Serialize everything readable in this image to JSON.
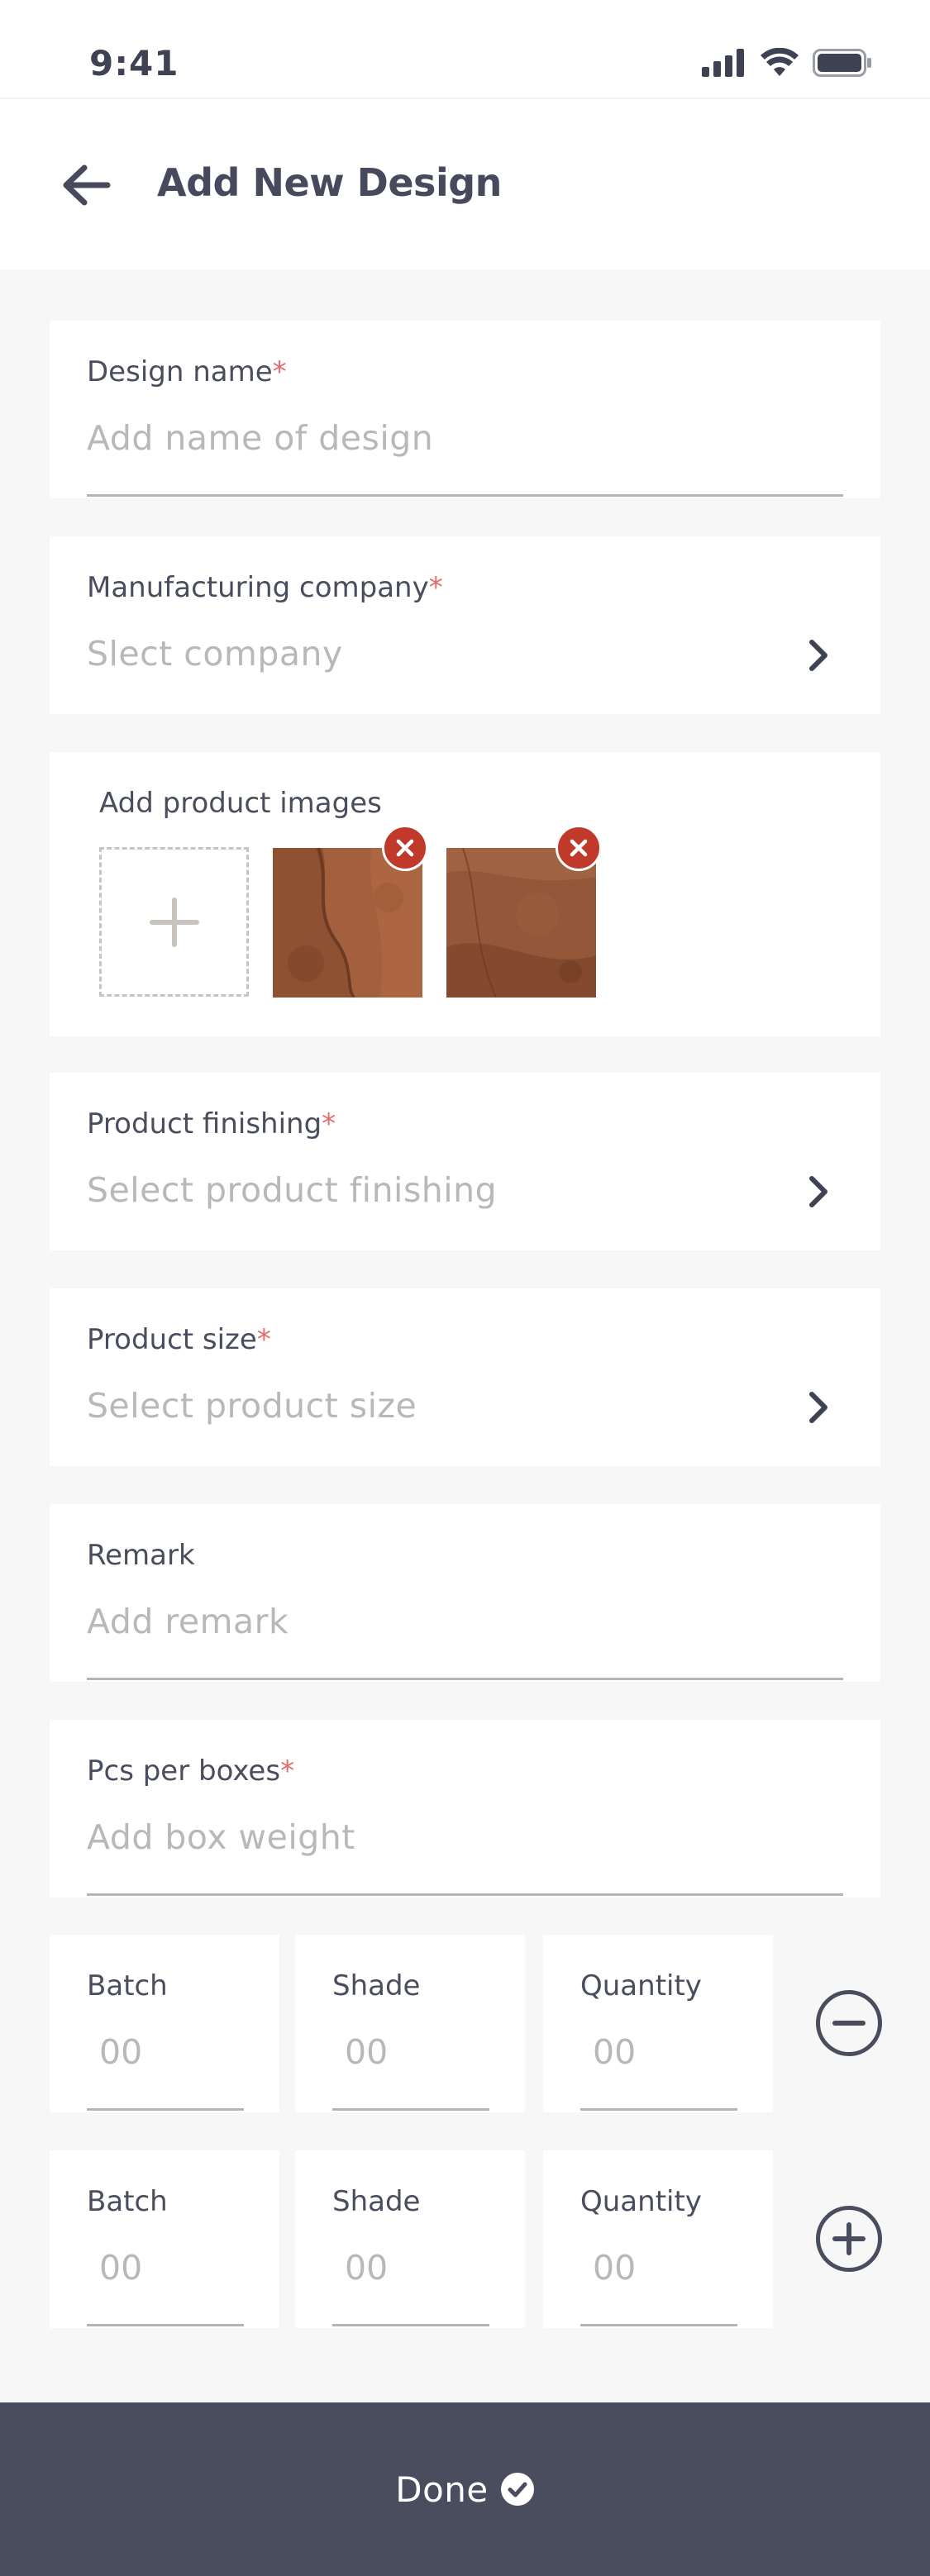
{
  "status_bar": {
    "time": "9:41",
    "icons": [
      "cellular-signal-icon",
      "wifi-icon",
      "battery-icon"
    ]
  },
  "header": {
    "title": "Add New Design",
    "back_icon": "arrow-left-icon"
  },
  "form": {
    "design_name": {
      "label": "Design name",
      "required_mark": "*",
      "placeholder": "Add name of design"
    },
    "manufacturing_company": {
      "label": "Manufacturing company",
      "required_mark": "*",
      "placeholder": "Slect company"
    },
    "product_images": {
      "label": "Add product images",
      "images": [
        "stone-texture-1",
        "stone-texture-2"
      ]
    },
    "product_finishing": {
      "label": "Product finishing",
      "required_mark": "*",
      "placeholder": "Select product finishing"
    },
    "product_size": {
      "label": "Product size",
      "required_mark": "*",
      "placeholder": "Select product size"
    },
    "remark": {
      "label": "Remark",
      "placeholder": "Add remark"
    },
    "pcs_per_boxes": {
      "label": "Pcs per boxes",
      "required_mark": "*",
      "placeholder": "Add box weight"
    },
    "batch_rows": [
      {
        "batch_label": "Batch",
        "batch_value": "00",
        "shade_label": "Shade",
        "shade_value": "00",
        "quantity_label": "Quantity",
        "quantity_value": "00",
        "action": "remove-row"
      },
      {
        "batch_label": "Batch",
        "batch_value": "00",
        "shade_label": "Shade",
        "shade_value": "00",
        "quantity_label": "Quantity",
        "quantity_value": "00",
        "action": "add-row"
      }
    ]
  },
  "footer": {
    "done_label": "Done",
    "done_icon": "check-circle-icon"
  },
  "colors": {
    "header_text": "#464a5c",
    "required": "#e36a6a",
    "placeholder": "#b8b8b8",
    "footer_bg": "#4a4d5e",
    "remove_badge": "#c0392b",
    "page_bg": "#f7f7f7"
  }
}
